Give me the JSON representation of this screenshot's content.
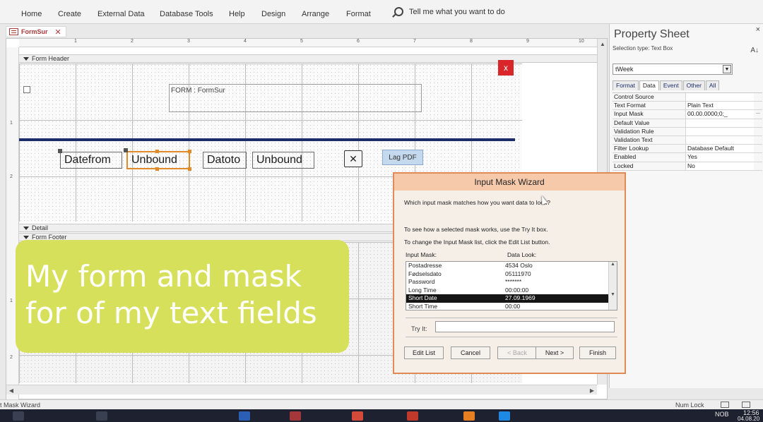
{
  "ribbon": {
    "tabs": [
      "Home",
      "Create",
      "External Data",
      "Database Tools",
      "Help",
      "Design",
      "Arrange",
      "Format"
    ],
    "tell_me": "Tell me what you want to do"
  },
  "document_tab": {
    "label": "FormSur",
    "close": "✕"
  },
  "design": {
    "ruler_numbers": [
      "1",
      "2",
      "3",
      "4",
      "5",
      "6",
      "7",
      "8",
      "9",
      "10"
    ],
    "left_ruler_numbers": [
      "1",
      "2",
      "1",
      "2"
    ],
    "sections": {
      "header": "Form Header",
      "detail": "Detail",
      "footer": "Form Footer"
    },
    "close_button": "x",
    "form_title": "FORM : FormSur",
    "label_from": "Datefrom",
    "textbox_1": "Unbound",
    "label_to": "Datoto",
    "textbox_2": "Unbound",
    "x_button": "✕",
    "pdf_button": "Lag PDF"
  },
  "property_sheet": {
    "title": "Property Sheet",
    "selection_type": "Selection type:  Text Box",
    "close": "×",
    "sort": "A↓",
    "object": "tWeek",
    "tabs": [
      "Format",
      "Data",
      "Event",
      "Other",
      "All"
    ],
    "active_tab": "Data",
    "rows": [
      {
        "name": "Control Source",
        "value": ""
      },
      {
        "name": "Text Format",
        "value": "Plain Text"
      },
      {
        "name": "Input Mask",
        "value": "00.00.0000;0;_"
      },
      {
        "name": "Default Value",
        "value": ""
      },
      {
        "name": "Validation Rule",
        "value": ""
      },
      {
        "name": "Validation Text",
        "value": ""
      },
      {
        "name": "Filter Lookup",
        "value": "Database Default"
      },
      {
        "name": "Enabled",
        "value": "Yes"
      },
      {
        "name": "Locked",
        "value": "No"
      }
    ],
    "builder_button": "..."
  },
  "wizard": {
    "title": "Input Mask Wizard",
    "question": "Which input mask matches how you want data to look?",
    "hint1": "To see how a selected mask works, use the Try It box.",
    "hint2": "To change the Input Mask list, click the Edit List button.",
    "col_mask": "Input Mask:",
    "col_look": "Data Look:",
    "items": [
      {
        "mask": "Postadresse",
        "look": "4534 Oslo"
      },
      {
        "mask": "Fødselsdato",
        "look": "05111970"
      },
      {
        "mask": "Password",
        "look": "*******"
      },
      {
        "mask": "Long Time",
        "look": "00:00:00"
      },
      {
        "mask": "Short Date",
        "look": "27.09.1969"
      },
      {
        "mask": "Short Time",
        "look": "00:00"
      }
    ],
    "selected_index": 4,
    "try_it_label": "Try It:",
    "buttons": {
      "edit_list": "Edit List",
      "cancel": "Cancel",
      "back": "< Back",
      "next": "Next >",
      "finish": "Finish"
    }
  },
  "overlay": {
    "line1": "My form and mask",
    "line2": "for of my text fields"
  },
  "status": {
    "left": "t Mask Wizard",
    "num_lock": "Num Lock"
  },
  "taskbar": {
    "lang": "NOB",
    "time": "12:56",
    "date": "04.08.20"
  }
}
